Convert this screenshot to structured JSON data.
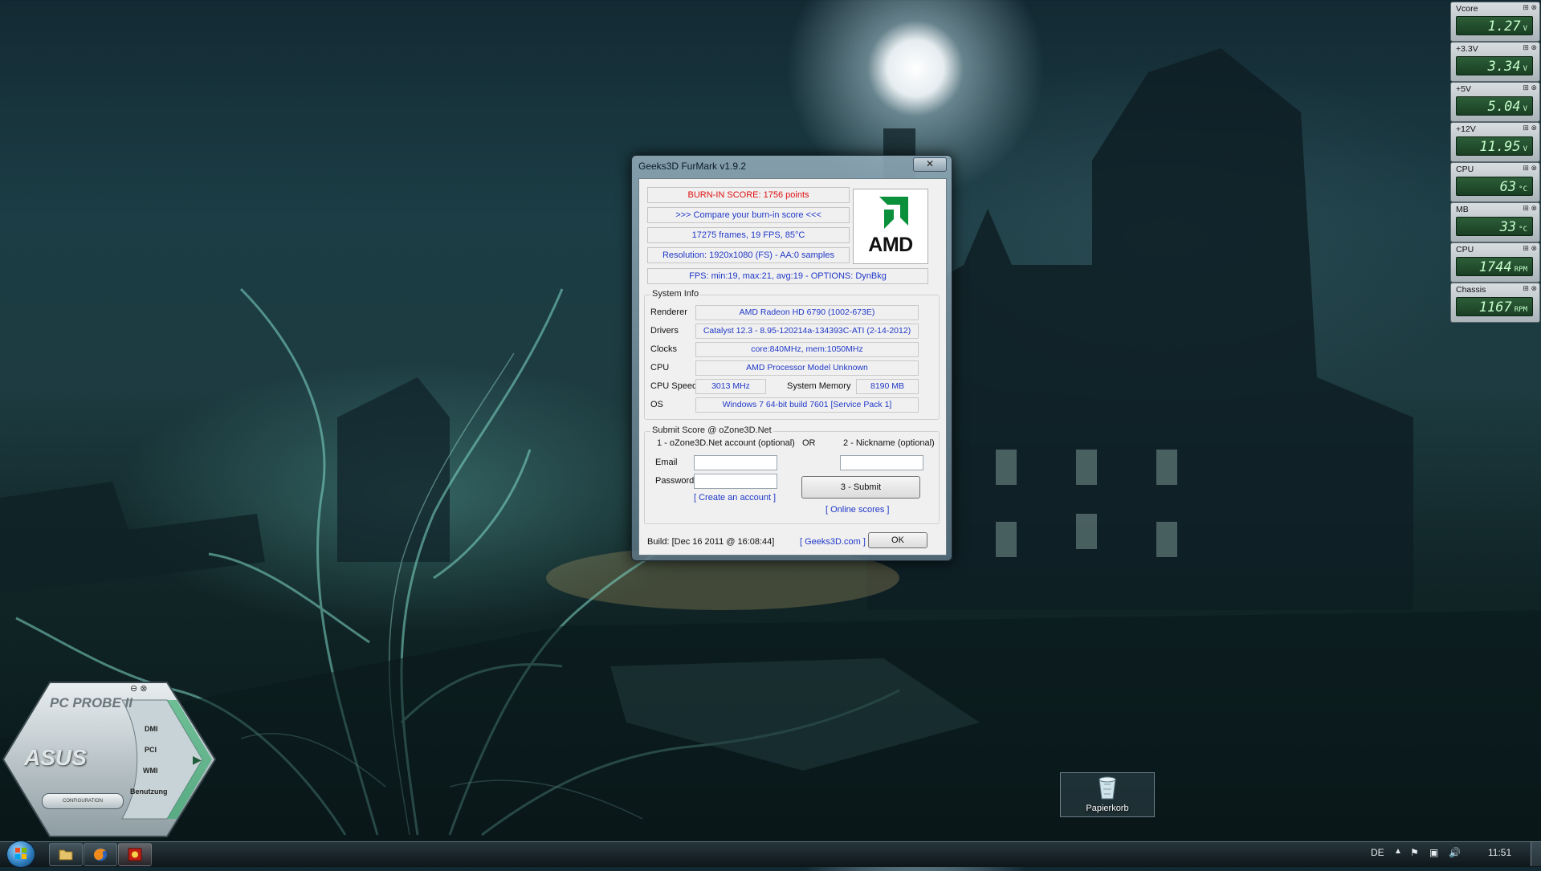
{
  "furmark": {
    "title": "Geeks3D FurMark v1.9.2",
    "close": "✕",
    "score": "BURN-IN SCORE: 1756 points",
    "compare": ">>> Compare your burn-in score <<<",
    "frames": "17275 frames, 19 FPS, 85°C",
    "resolution": "Resolution: 1920x1080 (FS) - AA:0 samples",
    "fps": "FPS: min:19, max:21, avg:19 - OPTIONS: DynBkg",
    "logo": "AMD",
    "sysinfo": {
      "legend": "System Info",
      "renderer_label": "Renderer",
      "renderer": "AMD Radeon HD 6790 (1002-673E)",
      "drivers_label": "Drivers",
      "drivers": "Catalyst 12.3 - 8.95-120214a-134393C-ATI (2-14-2012)",
      "clocks_label": "Clocks",
      "clocks": "core:840MHz, mem:1050MHz",
      "cpu_label": "CPU",
      "cpu": "AMD Processor Model Unknown",
      "cpuspeed_label": "CPU Speed",
      "cpuspeed": "3013 MHz",
      "sysmem_label": "System Memory",
      "sysmem": "8190 MB",
      "os_label": "OS",
      "os": "Windows 7 64-bit build 7601 [Service Pack 1]"
    },
    "submit": {
      "legend": "Submit Score @ oZone3D.Net",
      "account": "1 - oZone3D.Net account (optional)",
      "or": "OR",
      "nickname": "2 - Nickname (optional)",
      "email_label": "Email",
      "password_label": "Password",
      "create": "[ Create an account ]",
      "submit_btn": "3 - Submit",
      "online": "[ Online scores ]"
    },
    "build": "Build: [Dec 16 2011 @ 16:08:44]",
    "geeks_link": "[ Geeks3D.com ]",
    "ok": "OK"
  },
  "gadgets": [
    {
      "label": "Vcore",
      "value": "1.27",
      "unit": "V"
    },
    {
      "label": "+3.3V",
      "value": "3.34",
      "unit": "V"
    },
    {
      "label": "+5V",
      "value": "5.04",
      "unit": "V"
    },
    {
      "label": "+12V",
      "value": "11.95",
      "unit": "V"
    },
    {
      "label": "CPU",
      "value": "63",
      "unit": "°C"
    },
    {
      "label": "MB",
      "value": "33",
      "unit": "°C"
    },
    {
      "label": "CPU",
      "value": "1744",
      "unit": "RPM"
    },
    {
      "label": "Chassis",
      "value": "1167",
      "unit": "RPM"
    }
  ],
  "probe": {
    "title": "PC PROBE II",
    "brand": "ASUS",
    "items": [
      "DMI",
      "PCI",
      "WMI",
      "Benutzung"
    ],
    "config": "CONFIGURATION"
  },
  "desktop": {
    "recycle_label": "Papierkorb"
  },
  "taskbar": {
    "lang": "DE",
    "time": "11:51"
  }
}
